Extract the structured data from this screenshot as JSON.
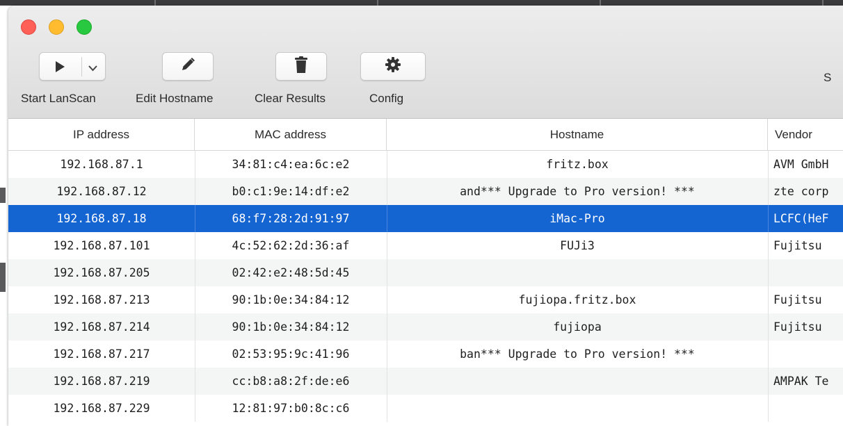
{
  "toolbar": {
    "start_label": "Start LanScan",
    "edit_label": "Edit Hostname",
    "clear_label": "Clear Results",
    "config_label": "Config",
    "search_cut_label": "S",
    "icons": {
      "start": "play-icon",
      "start_menu": "chevron-down-icon",
      "edit": "pencil-icon",
      "clear": "trash-icon",
      "config": "gear-icon"
    }
  },
  "window_controls": {
    "close": "#fe5f57",
    "minimize": "#febc2e",
    "zoom": "#28c840"
  },
  "table": {
    "columns": [
      "IP address",
      "MAC address",
      "Hostname",
      "Vendor"
    ],
    "selected_color": "#1464d2",
    "rows": [
      {
        "ip": "192.168.87.1",
        "mac": "34:81:c4:ea:6c:e2",
        "hostname": "fritz.box",
        "vendor": "AVM GmbH"
      },
      {
        "ip": "192.168.87.12",
        "mac": "b0:c1:9e:14:df:e2",
        "hostname": "and*** Upgrade to Pro version! ***",
        "vendor": "zte corp"
      },
      {
        "ip": "192.168.87.18",
        "mac": "68:f7:28:2d:91:97",
        "hostname": "iMac-Pro",
        "vendor": "LCFC(HeF",
        "selected": true
      },
      {
        "ip": "192.168.87.101",
        "mac": "4c:52:62:2d:36:af",
        "hostname": "FUJi3",
        "vendor": "Fujitsu"
      },
      {
        "ip": "192.168.87.205",
        "mac": "02:42:e2:48:5d:45",
        "hostname": "",
        "vendor": ""
      },
      {
        "ip": "192.168.87.213",
        "mac": "90:1b:0e:34:84:12",
        "hostname": "fujiopa.fritz.box",
        "vendor": "Fujitsu"
      },
      {
        "ip": "192.168.87.214",
        "mac": "90:1b:0e:34:84:12",
        "hostname": "fujiopa",
        "vendor": "Fujitsu"
      },
      {
        "ip": "192.168.87.217",
        "mac": "02:53:95:9c:41:96",
        "hostname": "ban*** Upgrade to Pro version! ***",
        "vendor": ""
      },
      {
        "ip": "192.168.87.219",
        "mac": "cc:b8:a8:2f:de:e6",
        "hostname": "",
        "vendor": "AMPAK Te"
      },
      {
        "ip": "192.168.87.229",
        "mac": "12:81:97:b0:8c:c6",
        "hostname": "",
        "vendor": ""
      }
    ]
  }
}
